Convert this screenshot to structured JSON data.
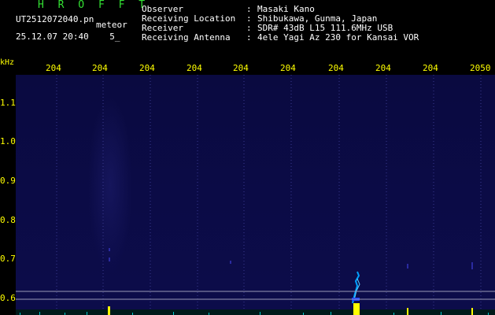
{
  "header": {
    "app_title": "H R O F F T",
    "file_name": "UT2512072040.pn",
    "tag": "meteor",
    "datetime": "25.12.07 20:40    5_"
  },
  "info": [
    {
      "label": "Observer",
      "value": "Masaki Kano"
    },
    {
      "label": "Receiving Location",
      "value": "Shibukawa, Gunma, Japan"
    },
    {
      "label": "Receiver",
      "value": "SDR# 43dB L15 111.6MHz USB"
    },
    {
      "label": "Receiving Antenna",
      "value": "4ele Yagi Az 230 for Kansai VOR"
    }
  ],
  "info_colon": ":",
  "axis": {
    "y_unit": "kHz",
    "x_ticks": [
      "204",
      "204",
      "204",
      "204",
      "204",
      "204",
      "204",
      "204",
      "204",
      "2050"
    ],
    "y_ticks": [
      "1.1",
      "1.0",
      "0.9",
      "0.8",
      "0.7",
      "0.6"
    ]
  },
  "colors": {
    "text_green": "#33e033",
    "text_yellow": "#ffff00",
    "text_white": "#ffffff",
    "background": "#000000",
    "waterfall": "#0b0b46",
    "signal": "#00e5ff"
  },
  "signals": {
    "carrier_band_khz": [
      0.59,
      0.62
    ],
    "meteor_echo_khz": [
      0.598,
      0.665
    ],
    "echo_minute": 20.47
  }
}
